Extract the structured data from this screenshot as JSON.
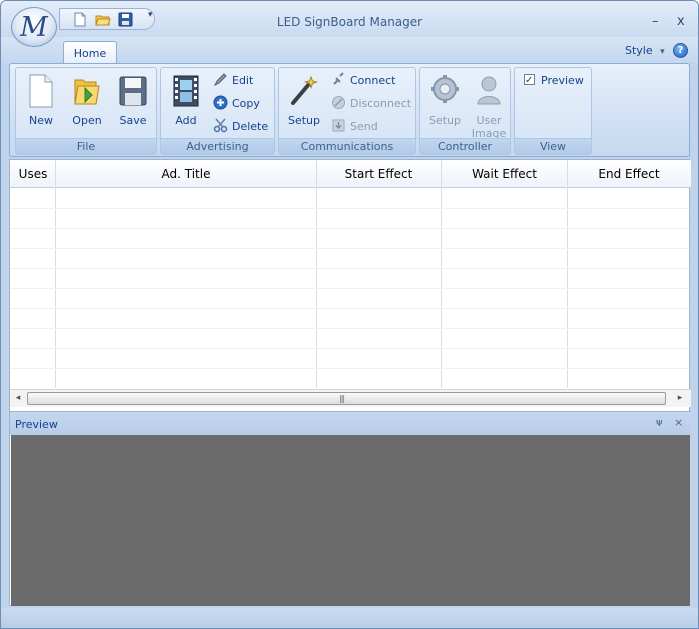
{
  "window": {
    "title": "LED SignBoard Manager",
    "minimize_label": "–",
    "close_label": "x",
    "orb_letter": "M"
  },
  "quick_access": {
    "dropdown_label": "▾"
  },
  "tabs": {
    "home_label": "Home",
    "style_label": "Style",
    "style_dropdown": "▾",
    "help_label": "?"
  },
  "ribbon": {
    "file": {
      "label": "File",
      "new_label": "New",
      "open_label": "Open",
      "save_label": "Save"
    },
    "advertising": {
      "label": "Advertising",
      "add_label": "Add",
      "edit_label": "Edit",
      "copy_label": "Copy",
      "delete_label": "Delete"
    },
    "communications": {
      "label": "Communications",
      "setup_label": "Setup",
      "connect_label": "Connect",
      "disconnect_label": "Disconnect",
      "send_label": "Send"
    },
    "controller": {
      "label": "Controller",
      "setup_label": "Setup",
      "user_image_label_line1": "User",
      "user_image_label_line2": "Image"
    },
    "view": {
      "label": "View",
      "preview_label": "Preview",
      "preview_checked": true
    }
  },
  "table": {
    "columns": [
      "Uses",
      "Ad. Title",
      "Start Effect",
      "Wait Effect",
      "End Effect"
    ],
    "rows": []
  },
  "hscroll": {
    "left_arrow": "◂",
    "right_arrow": "▸",
    "grip": "|||"
  },
  "preview_panel": {
    "title": "Preview",
    "pin_icon": "ᴪ",
    "close_icon": "×"
  },
  "colors": {
    "ribbon_bg": "#c5d9f0",
    "preview_bg": "#6b6b6b",
    "text_blue": "#15428b"
  }
}
